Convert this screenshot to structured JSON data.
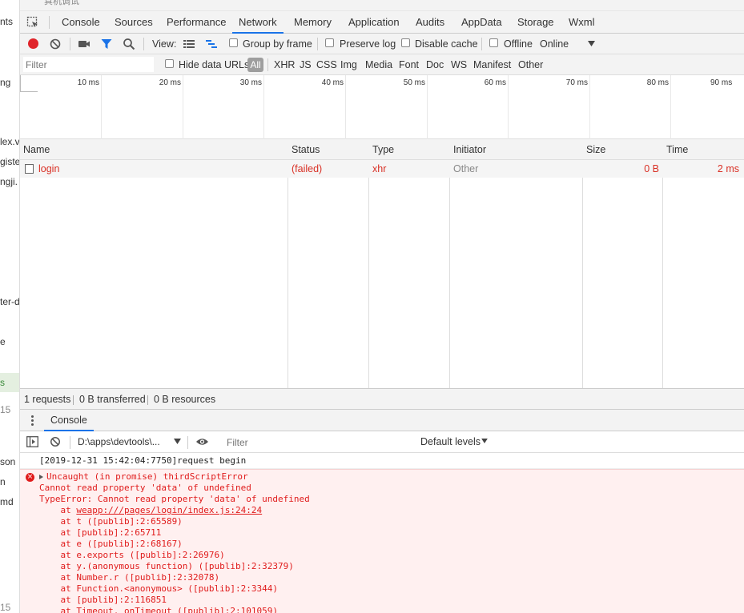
{
  "left_strip": {
    "fragments": [
      {
        "text": "nts"
      },
      {
        "text": "ng"
      },
      {
        "text": "lex.v"
      },
      {
        "text": "giste"
      },
      {
        "text": "ngji."
      },
      {
        "text": "ter-d"
      },
      {
        "text": "e"
      },
      {
        "text": "s"
      },
      {
        "text": "15"
      },
      {
        "text": "son"
      },
      {
        "text": "n"
      },
      {
        "text": "md"
      },
      {
        "text": "15"
      }
    ]
  },
  "top_sliver": "真机调试",
  "tabs": [
    "Console",
    "Sources",
    "Performance",
    "Network",
    "Memory",
    "Application",
    "Audits",
    "AppData",
    "Storage",
    "Wxml"
  ],
  "active_tab": "Network",
  "toolbar": {
    "view_label": "View:",
    "group_by_frame": "Group by frame",
    "preserve_log": "Preserve log",
    "disable_cache": "Disable cache",
    "offline": "Offline",
    "throttle": "Online"
  },
  "filter_bar": {
    "placeholder": "Filter",
    "hide_data_urls": "Hide data URLs",
    "all": "All",
    "types": [
      "XHR",
      "JS",
      "CSS",
      "Img",
      "Media",
      "Font",
      "Doc",
      "WS",
      "Manifest",
      "Other"
    ]
  },
  "timeline": {
    "ticks": [
      "10 ms",
      "20 ms",
      "30 ms",
      "40 ms",
      "50 ms",
      "60 ms",
      "70 ms",
      "80 ms",
      "90 ms"
    ]
  },
  "table": {
    "columns": [
      "Name",
      "Status",
      "Type",
      "Initiator",
      "Size",
      "Time"
    ],
    "rows": [
      {
        "name": "login",
        "status": "(failed)",
        "type": "xhr",
        "initiator": "Other",
        "size": "0 B",
        "time": "2 ms"
      }
    ]
  },
  "statusbar": {
    "requests": "1 requests",
    "transferred": "0 B transferred",
    "resources": "0 B resources"
  },
  "drawer": {
    "tab": "Console"
  },
  "console_toolbar": {
    "context": "D:\\apps\\devtools\\...",
    "filter_placeholder": "Filter",
    "levels": "Default levels"
  },
  "console": {
    "log": "[2019-12-31 15:42:04:7750]request begin",
    "error_header": "Uncaught (in promise) thirdScriptError",
    "error_lines": [
      "Cannot read property 'data' of undefined",
      "TypeError: Cannot read property 'data' of undefined"
    ],
    "stack_link_prefix": "    at ",
    "stack_link": "weapp:///pages/login/index.js:24:24",
    "stack": [
      "    at t ([publib]:2:65589)",
      "    at [publib]:2:65711",
      "    at e ([publib]:2:68167)",
      "    at e.exports ([publib]:2:26976)",
      "    at y.(anonymous function) ([publib]:2:32379)",
      "    at Number.r ([publib]:2:32078)",
      "    at Function.<anonymous> ([publib]:2:3344)",
      "    at [publib]:2:116851",
      "    at Timeout._onTimeout ([publib]:2:101059)"
    ]
  }
}
